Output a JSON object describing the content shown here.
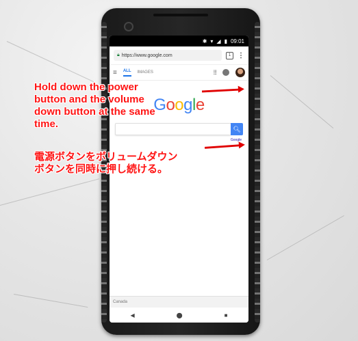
{
  "status_bar": {
    "time": "09:01",
    "icons": [
      "bluetooth-icon",
      "wifi-icon",
      "signal-icon",
      "battery-icon"
    ]
  },
  "browser": {
    "url": "https://www.google.com",
    "tab_count": "1",
    "menu_icon": "kebab-menu-icon"
  },
  "google_nav": {
    "tab_all": "ALL",
    "tab_images": "IMAGES"
  },
  "logo": {
    "letters": [
      "G",
      "o",
      "o",
      "g",
      "l",
      "e"
    ],
    "colors": [
      "#4285f4",
      "#ea4335",
      "#fbbc05",
      "#4285f4",
      "#34a853",
      "#ea4335"
    ]
  },
  "search": {
    "placeholder": "",
    "offered_text": "Google"
  },
  "footer": {
    "location": "Canada"
  },
  "android_nav": {
    "back": "◀",
    "home": "⬤",
    "recents": "■"
  },
  "overlay": {
    "english": "Hold down the power\nbutton and the volume\ndown button at the same\ntime.",
    "japanese": "電源ボタンをボリュームダウン\nボタンを同時に押し続ける。",
    "color": "#ff1414"
  }
}
